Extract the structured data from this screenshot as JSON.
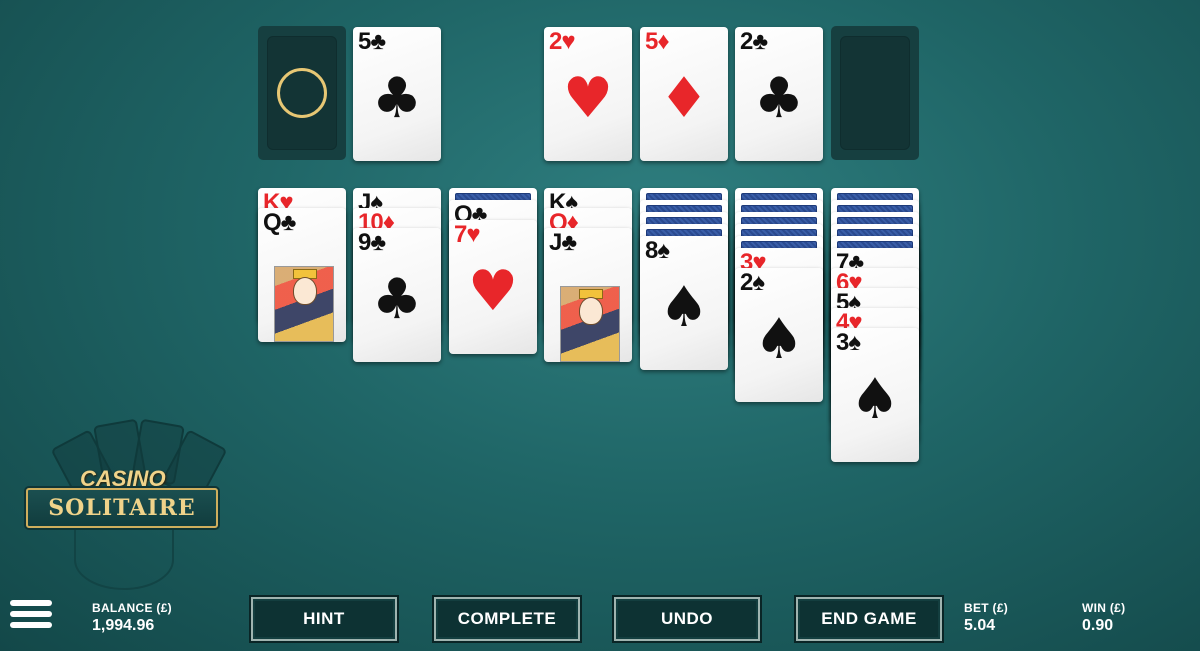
{
  "logo": {
    "casino": "CASINO",
    "solitaire": "SOLITAIRE"
  },
  "stock": {
    "state": "empty-recycle"
  },
  "waste": [
    {
      "rank": "5",
      "suit": "♣",
      "color": "black"
    }
  ],
  "foundations": [
    {
      "rank": "2",
      "suit": "♥",
      "color": "red"
    },
    {
      "rank": "5",
      "suit": "♦",
      "color": "red"
    },
    {
      "rank": "2",
      "suit": "♣",
      "color": "black"
    },
    {
      "rank": "",
      "suit": "",
      "color": "",
      "empty": true
    }
  ],
  "tableau": [
    {
      "facedown": 0,
      "cards": [
        {
          "rank": "K",
          "suit": "♥",
          "color": "red"
        },
        {
          "rank": "Q",
          "suit": "♣",
          "color": "black",
          "face": true
        }
      ]
    },
    {
      "facedown": 0,
      "cards": [
        {
          "rank": "J",
          "suit": "♠",
          "color": "black"
        },
        {
          "rank": "10",
          "suit": "♦",
          "color": "red"
        },
        {
          "rank": "9",
          "suit": "♣",
          "color": "black"
        }
      ]
    },
    {
      "facedown": 1,
      "cards": [
        {
          "rank": "Q",
          "suit": "♣",
          "color": "black"
        },
        {
          "rank": "7",
          "suit": "♥",
          "color": "red"
        }
      ]
    },
    {
      "facedown": 0,
      "cards": [
        {
          "rank": "K",
          "suit": "♠",
          "color": "black"
        },
        {
          "rank": "Q",
          "suit": "♦",
          "color": "red"
        },
        {
          "rank": "J",
          "suit": "♣",
          "color": "black",
          "face": true
        }
      ]
    },
    {
      "facedown": 4,
      "cards": [
        {
          "rank": "8",
          "suit": "♠",
          "color": "black"
        }
      ]
    },
    {
      "facedown": 5,
      "cards": [
        {
          "rank": "3",
          "suit": "♥",
          "color": "red"
        },
        {
          "rank": "2",
          "suit": "♠",
          "color": "black"
        }
      ]
    },
    {
      "facedown": 5,
      "cards": [
        {
          "rank": "7",
          "suit": "♣",
          "color": "black"
        },
        {
          "rank": "6",
          "suit": "♥",
          "color": "red"
        },
        {
          "rank": "5",
          "suit": "♠",
          "color": "black"
        },
        {
          "rank": "4",
          "suit": "♥",
          "color": "red"
        },
        {
          "rank": "3",
          "suit": "♠",
          "color": "black"
        }
      ]
    }
  ],
  "footer": {
    "balance_label": "BALANCE (£)",
    "balance_value": "1,994.96",
    "bet_label": "BET (£)",
    "bet_value": "5.04",
    "win_label": "WIN (£)",
    "win_value": "0.90",
    "buttons": {
      "hint": "HINT",
      "complete": "COMPLETE",
      "undo": "UNDO",
      "end_game": "END GAME"
    }
  },
  "colors": {
    "felt": "#1f6566",
    "gold": "#f0d38a",
    "red_suit": "#e8262a",
    "card_back": "#2b4b91"
  }
}
